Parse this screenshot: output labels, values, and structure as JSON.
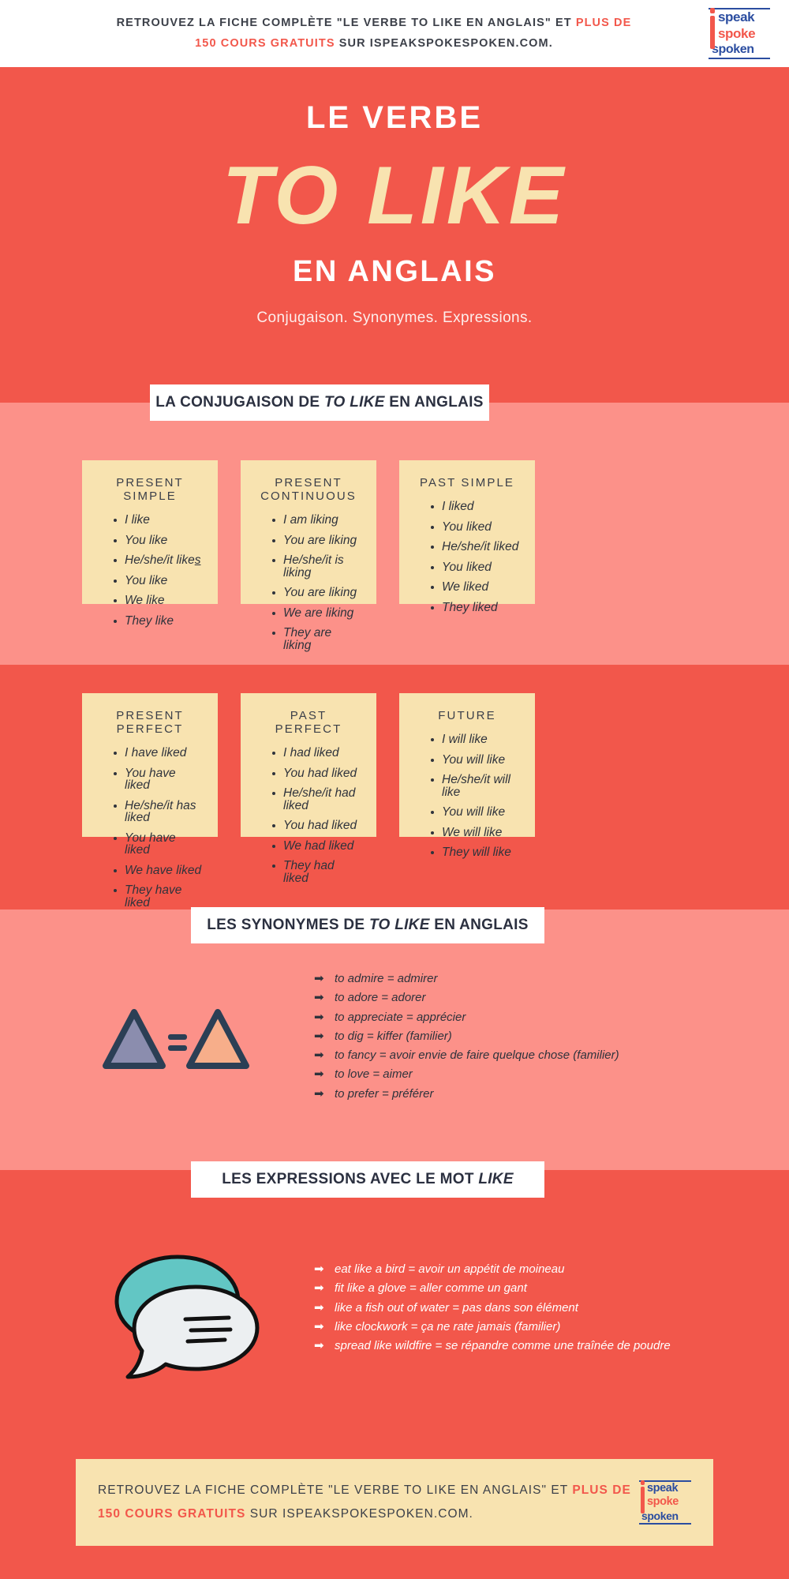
{
  "topbar": {
    "line1_a": "RETROUVEZ LA FICHE COMPLÈTE \"LE VERBE TO LIKE EN ANGLAIS\" ET ",
    "line1_b": "PLUS DE",
    "line2_a": "150 COURS GRATUITS",
    "line2_b": " SUR ISPEAKSPOKESPOKEN.COM."
  },
  "logo": {
    "speak": "speak",
    "spoke": "spoke",
    "spoken": "spoken"
  },
  "hero": {
    "kicker": "LE VERBE",
    "title": "TO LIKE",
    "subtitle": "EN ANGLAIS",
    "tagline": "Conjugaison. Synonymes.  Expressions."
  },
  "sections": {
    "conjugation_banner": {
      "pre": "LA CONJUGAISON DE ",
      "em": "TO LIKE",
      "post": " EN ANGLAIS"
    },
    "synonyms_banner": {
      "pre": "LES SYNONYMES DE ",
      "em": "TO LIKE",
      "post": " EN ANGLAIS"
    },
    "expressions_banner": {
      "pre": "LES EXPRESSIONS AVEC LE MOT ",
      "em": "LIKE",
      "post": ""
    }
  },
  "conjugation": {
    "cards": [
      {
        "title": "PRESENT SIMPLE",
        "items": [
          "I like",
          "You like",
          "He/she/it like",
          "You like",
          "We like",
          "They like"
        ],
        "underline_index": 2,
        "underline_suffix": "s"
      },
      {
        "title": "PRESENT CONTINUOUS",
        "items": [
          "I am liking",
          "You are liking",
          "He/she/it is liking",
          "You are liking",
          "We are liking",
          "They are liking"
        ]
      },
      {
        "title": "PAST SIMPLE",
        "items": [
          "I liked",
          "You liked",
          "He/she/it liked",
          "You liked",
          "We liked",
          "They liked"
        ]
      },
      {
        "title": "PRESENT PERFECT",
        "items": [
          "I have liked",
          "You have liked",
          "He/she/it has liked",
          "You have liked",
          "We have liked",
          "They have liked"
        ]
      },
      {
        "title": "PAST PERFECT",
        "items": [
          "I had liked",
          "You had liked",
          "He/she/it had liked",
          "You had liked",
          "We had liked",
          "They had liked"
        ]
      },
      {
        "title": "FUTURE",
        "items": [
          "I will like",
          "You will like",
          "He/she/it will like",
          "You will like",
          "We will like",
          "They will like"
        ]
      }
    ]
  },
  "synonyms": {
    "arrow_glyph": "➡",
    "items": [
      "to admire = admirer",
      "to adore = adorer",
      "to appreciate = apprécier",
      "to dig = kiffer (familier)",
      "to fancy = avoir envie de faire quelque chose (familier)",
      "to love = aimer",
      "to prefer = préférer"
    ]
  },
  "expressions": {
    "arrow_glyph": "➡",
    "items": [
      "eat like a bird = avoir un appétit de moineau",
      "fit like a glove = aller comme un gant",
      "like a fish out of water = pas dans son élément",
      "like clockwork = ça ne rate jamais (familier)",
      "spread like wildfire = se répandre comme une traînée de poudre"
    ]
  },
  "footer": {
    "a": "RETROUVEZ LA FICHE COMPLÈTE \"LE VERBE TO LIKE EN ANGLAIS\" ET ",
    "b": "PLUS DE 150 COURS GRATUITS",
    "c": " SUR ISPEAKSPOKESPOKEN.COM."
  },
  "colors": {
    "coral": "#f2574b",
    "salmon": "#fc9189",
    "cream": "#f8e3b0",
    "navy": "#2b3040",
    "logo_blue": "#2b4da0",
    "teal": "#62c6c4",
    "purple": "#8b8dae",
    "peach": "#f7ae8a"
  }
}
